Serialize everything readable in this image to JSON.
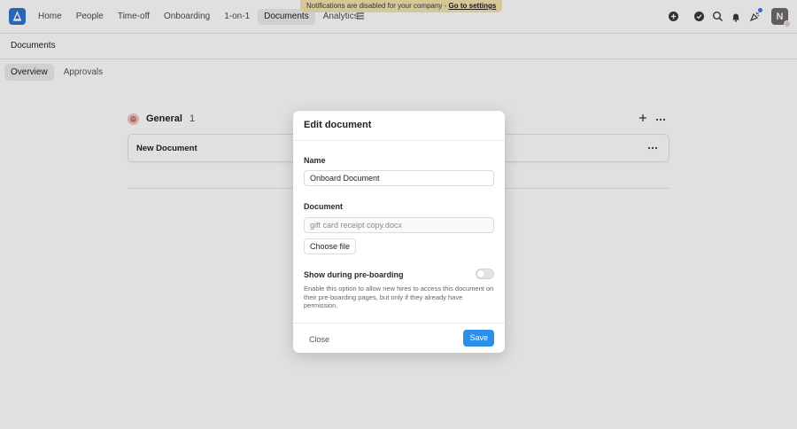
{
  "banner": {
    "text": "Notifications are disabled for your company - ",
    "link": "Go to settings"
  },
  "nav": {
    "items": [
      "Home",
      "People",
      "Time-off",
      "Onboarding",
      "1-on-1",
      "Documents",
      "Analytics"
    ],
    "active": "Documents",
    "avatar_initial": "N"
  },
  "page": {
    "title": "Documents",
    "tabs": [
      "Overview",
      "Approvals"
    ]
  },
  "group": {
    "title": "General",
    "count": "1",
    "documents": [
      {
        "name": "New Document"
      }
    ]
  },
  "modal": {
    "title": "Edit document",
    "name_label": "Name",
    "name_value": "Onboard Document",
    "document_label": "Document",
    "document_value": "gift card receipt copy.docx",
    "choose_file": "Choose file",
    "toggle_label": "Show during pre-boarding",
    "toggle_on": false,
    "help_text": "Enable this option to allow new hires to access this document on their pre-boarding pages, but only if they already have permission.",
    "close": "Close",
    "save": "Save"
  },
  "colors": {
    "accent": "#2b8ee8",
    "logo": "#2f73d0",
    "banner": "#f3e3ad"
  }
}
